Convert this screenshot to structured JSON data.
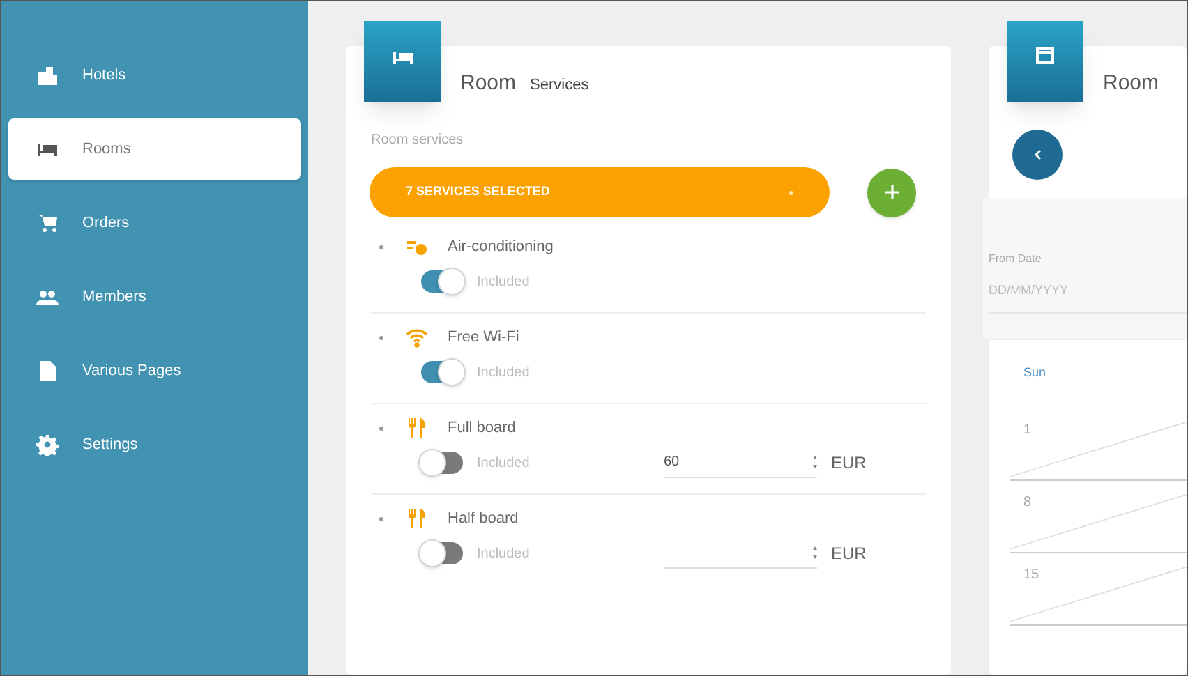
{
  "sidebar": {
    "items": [
      {
        "kind": "hotel",
        "label": "Hotels",
        "selected": false
      },
      {
        "kind": "bed",
        "label": "Rooms",
        "selected": true
      },
      {
        "kind": "cart",
        "label": "Orders",
        "selected": false
      },
      {
        "kind": "people",
        "label": "Members",
        "selected": false
      },
      {
        "kind": "page",
        "label": "Various Pages",
        "selected": false
      },
      {
        "kind": "gear",
        "label": "Settings",
        "selected": false
      }
    ]
  },
  "services_card": {
    "title": "Room",
    "subtitle": "Services",
    "field_label": "Room services",
    "select_value": "7 SERVICES SELECTED",
    "services": [
      {
        "kind": "ac",
        "name": "Air-conditioning",
        "included": true,
        "included_label": "Included"
      },
      {
        "kind": "wifi",
        "name": "Free Wi-Fi",
        "included": true,
        "included_label": "Included"
      },
      {
        "kind": "food",
        "name": "Full board",
        "included": false,
        "included_label": "Included",
        "price": "60",
        "currency": "EUR"
      },
      {
        "kind": "food",
        "name": "Half board",
        "included": false,
        "included_label": "Included",
        "currency": "EUR"
      }
    ]
  },
  "calendar_card": {
    "title": "Room",
    "from_label": "From Date",
    "from_placeholder": "DD/MM/YYYY",
    "weekday": "Sun",
    "days": [
      "1",
      "8",
      "15"
    ]
  }
}
